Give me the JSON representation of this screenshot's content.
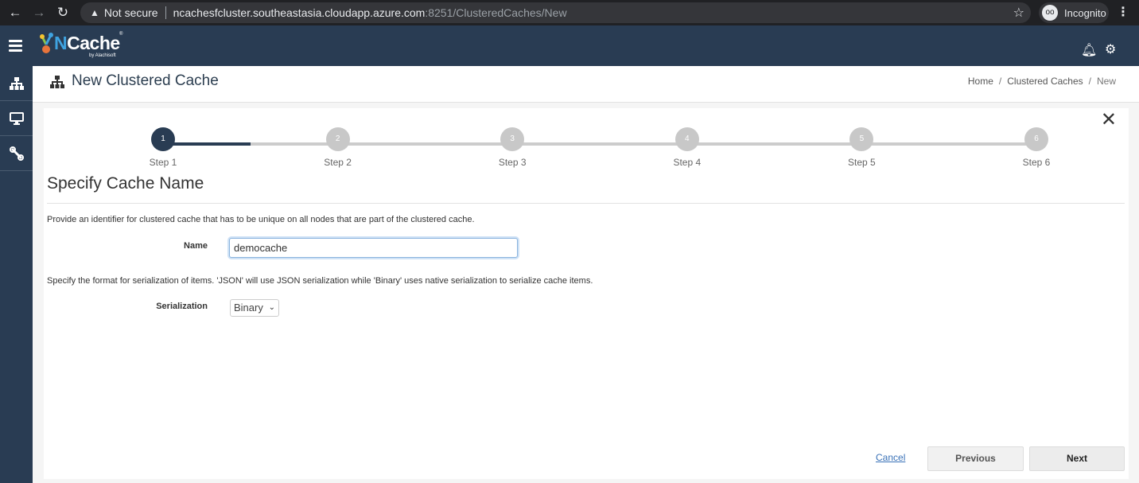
{
  "browser": {
    "security_label": "Not secure",
    "url_host": "ncachesfcluster.southeastasia.cloudapp.azure.com",
    "url_path": ":8251/ClusteredCaches/New",
    "profile_label": "Incognito"
  },
  "app": {
    "logo_text_n": "N",
    "logo_text_rest": "Cache",
    "logo_byline": "by Alachisoft"
  },
  "sidebar": {
    "items": [
      {
        "icon": "sitemap-icon",
        "glyph": "⛓"
      },
      {
        "icon": "monitor-icon",
        "glyph": "🖵"
      },
      {
        "icon": "tools-icon",
        "glyph": "✂"
      }
    ]
  },
  "page": {
    "title": "New Clustered Cache",
    "breadcrumb": [
      "Home",
      "Clustered Caches",
      "New"
    ]
  },
  "wizard": {
    "current_step": 1,
    "progress_fraction": 0.5,
    "steps": [
      {
        "number": "1",
        "label": "Step 1"
      },
      {
        "number": "2",
        "label": "Step 2"
      },
      {
        "number": "3",
        "label": "Step 3"
      },
      {
        "number": "4",
        "label": "Step 4"
      },
      {
        "number": "5",
        "label": "Step 5"
      },
      {
        "number": "6",
        "label": "Step 6"
      }
    ],
    "section_title": "Specify Cache Name",
    "name_description": "Provide an identifier for clustered cache that has to be unique on all nodes that are part of the clustered cache.",
    "name_label": "Name",
    "name_value": "democache",
    "serialization_description": "Specify the format for serialization of items. 'JSON' will use JSON serialization while 'Binary' uses native serialization to serialize cache items.",
    "serialization_label": "Serialization",
    "serialization_value": "Binary",
    "cancel_label": "Cancel",
    "previous_label": "Previous",
    "next_label": "Next"
  }
}
